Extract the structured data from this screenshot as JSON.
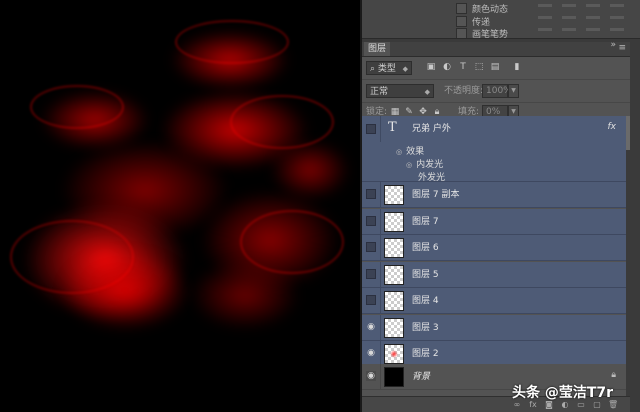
{
  "mini_panel": {
    "items": [
      "颜色动态",
      "传递",
      "画笔笔势"
    ]
  },
  "layers_panel": {
    "title": "图层",
    "filter_label": "类型",
    "blend_mode": "正常",
    "opacity_label": "不透明度:",
    "opacity_value": "100%",
    "lock_label": "锁定:",
    "fill_label": "填充:",
    "fill_value": "0%",
    "text_layer": {
      "icon": "T",
      "name": "兄弟 户外",
      "fx": "fx",
      "effects_label": "效果",
      "effects": [
        "内发光",
        "外发光"
      ]
    },
    "layers": [
      {
        "name": "图层 7 副本",
        "visible": false,
        "thumb": "transparent"
      },
      {
        "name": "图层 7",
        "visible": false,
        "thumb": "transparent"
      },
      {
        "name": "图层 6",
        "visible": false,
        "thumb": "transparent"
      },
      {
        "name": "图层 5",
        "visible": false,
        "thumb": "transparent"
      },
      {
        "name": "图层 4",
        "visible": false,
        "thumb": "transparent"
      },
      {
        "name": "图层 3",
        "visible": true,
        "thumb": "transparent"
      },
      {
        "name": "图层 2",
        "visible": true,
        "thumb": "red"
      }
    ],
    "background_layer": {
      "name": "背景",
      "visible": true
    }
  },
  "watermark": "头条 @莹洁T7r",
  "colors": {
    "selected_layer": "#4e5b76",
    "panel_bg": "#535353",
    "flame": "#e00000"
  }
}
